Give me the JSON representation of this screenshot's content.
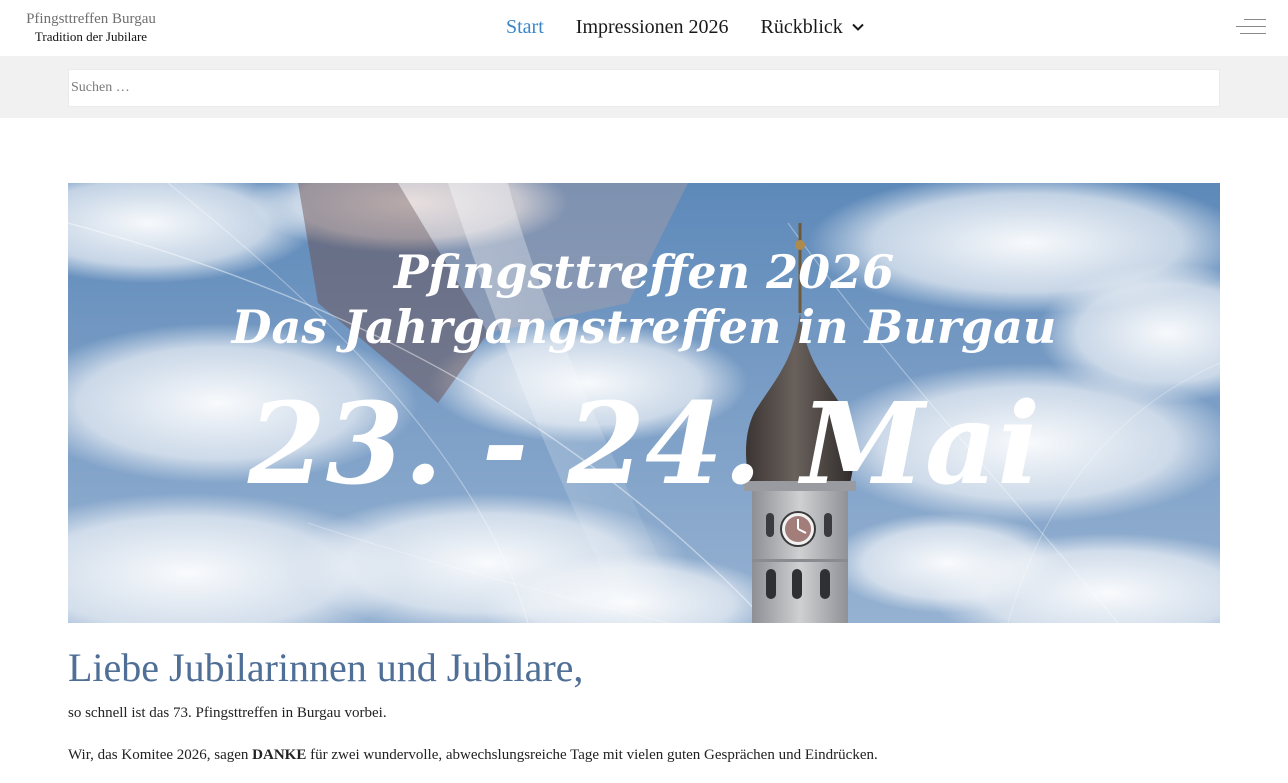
{
  "brand": {
    "title": "Pfingsttreffen Burgau",
    "subtitle": "Tradition der Jubilare"
  },
  "nav": {
    "items": [
      {
        "label": "Start",
        "active": true
      },
      {
        "label": "Impressionen 2026",
        "active": false
      },
      {
        "label": "Rückblick",
        "active": false,
        "has_dropdown": true
      }
    ],
    "menu_icon": "hamburger-menu-icon"
  },
  "search": {
    "placeholder": "Suchen …",
    "value": ""
  },
  "hero": {
    "line1": "Pfingsttreffen 2026",
    "line2": "Das Jahrgangstreffen in Burgau",
    "date": "23. - 24. Mai",
    "image": "sky-with-clouds-and-church-tower"
  },
  "content": {
    "heading": "Liebe Jubilarinnen und Jubilare,",
    "paragraph1": "so schnell ist das 73. Pfingsttreffen in Burgau vorbei.",
    "paragraph2_before": "Wir, das Komitee 2026, sagen ",
    "paragraph2_bold": "DANKE",
    "paragraph2_after": " für zwei wundervolle, abwechslungsreiche Tage mit vielen guten Gesprächen und Eindrücken."
  },
  "colors": {
    "accent": "#3a86c8",
    "heading": "#4f6f97",
    "search_band": "#f1f1f1"
  }
}
